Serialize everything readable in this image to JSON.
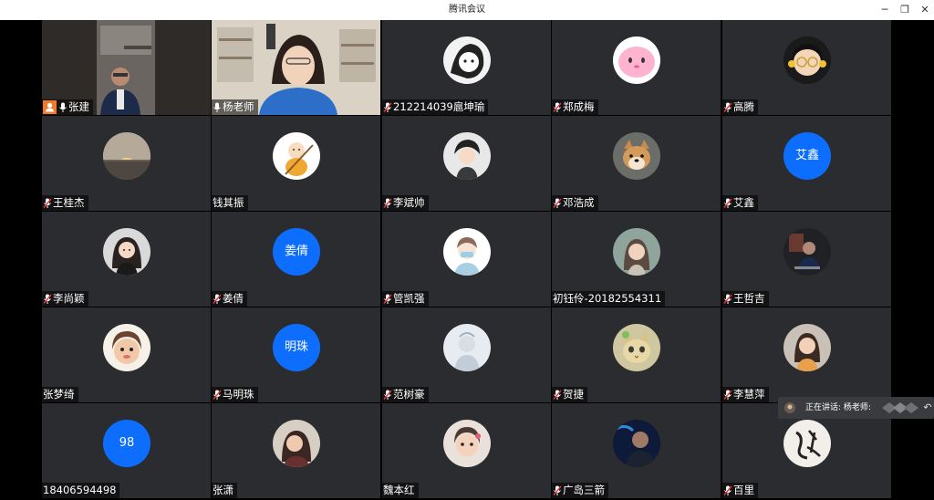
{
  "window": {
    "title": "腾讯会议",
    "minimize": "─",
    "restore": "❐",
    "close": "✕"
  },
  "participants": [
    {
      "name": "张建",
      "mic": "on",
      "host": true,
      "video": true
    },
    {
      "name": "杨老师",
      "mic": "on",
      "video": true,
      "speaking": true
    },
    {
      "name": "212214039扈坤瑜",
      "mic": "muted",
      "avatar": "sketch-girl-avatar"
    },
    {
      "name": "郑成梅",
      "mic": "muted",
      "avatar": "pink-blob-avatar"
    },
    {
      "name": "高腾",
      "mic": "muted",
      "avatar": "cartoon-glasses-girl-avatar"
    },
    {
      "name": "王桂杰",
      "mic": "muted",
      "avatar": "sunset-landscape-avatar"
    },
    {
      "name": "钱其振",
      "mic": "none",
      "avatar": "cartoon-monk-avatar"
    },
    {
      "name": "李斌帅",
      "mic": "muted",
      "avatar": "anime-boy-avatar"
    },
    {
      "name": "邓浩成",
      "mic": "muted",
      "avatar": "shiba-dog-avatar"
    },
    {
      "name": "艾鑫",
      "mic": "muted",
      "avatar_text": "艾鑫"
    },
    {
      "name": "李尚颖",
      "mic": "muted",
      "avatar": "cartoon-woman-avatar"
    },
    {
      "name": "姜倩",
      "mic": "muted",
      "avatar_text": "姜倩"
    },
    {
      "name": "管凯强",
      "mic": "muted",
      "avatar": "cartoon-mask-girl-avatar"
    },
    {
      "name": "初钰伶-20182554311",
      "mic": "none",
      "avatar": "illustrated-girl-avatar"
    },
    {
      "name": "王哲吉",
      "mic": "muted",
      "avatar": "dark-photo-avatar"
    },
    {
      "name": "张梦绮",
      "mic": "none",
      "avatar": "child-photo-avatar"
    },
    {
      "name": "马明珠",
      "mic": "muted",
      "avatar_text": "明珠"
    },
    {
      "name": "范树豪",
      "mic": "muted",
      "avatar": "pale-photo-avatar"
    },
    {
      "name": "贺捷",
      "mic": "muted",
      "avatar": "cat-avatar"
    },
    {
      "name": "李慧萍",
      "mic": "muted",
      "avatar": "woman-photo-avatar"
    },
    {
      "name": "18406594498",
      "mic": "none",
      "avatar_text": "98"
    },
    {
      "name": "张潇",
      "mic": "none",
      "avatar": "woman-portrait-avatar"
    },
    {
      "name": "魏本红",
      "mic": "none",
      "avatar": "toddler-photo-avatar"
    },
    {
      "name": "广岛三箭",
      "mic": "muted",
      "avatar": "man-photo-avatar"
    },
    {
      "name": "百里",
      "mic": "muted",
      "avatar": "calligraphy-avatar"
    }
  ],
  "speaking_indicator": {
    "label": "正在讲话: 杨老师:"
  },
  "colors": {
    "tile_bg": "#2b2c2f",
    "text_avatar": "#0d6efd",
    "active_border": "#2fbf71",
    "host_badge": "#f07c2a",
    "mic_muted": "#e53935"
  }
}
